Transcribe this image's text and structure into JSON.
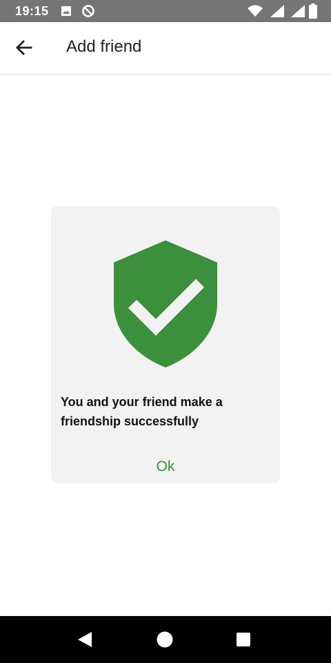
{
  "status_bar": {
    "time": "19:15",
    "icons": [
      "image-icon",
      "data-saver-icon",
      "wifi-icon",
      "signal-icon",
      "signal-icon",
      "battery-icon"
    ]
  },
  "app_bar": {
    "title": "Add friend",
    "back_icon": "arrow-back-icon"
  },
  "dialog": {
    "icon": "shield-check-icon",
    "icon_color": "#3c8f3c",
    "message": "You and your friend make a friendship successfully",
    "ok_label": "Ok",
    "ok_color": "#3c8f3c"
  },
  "nav_bar": {
    "icons": [
      "back-triangle-icon",
      "home-circle-icon",
      "recents-square-icon"
    ]
  }
}
